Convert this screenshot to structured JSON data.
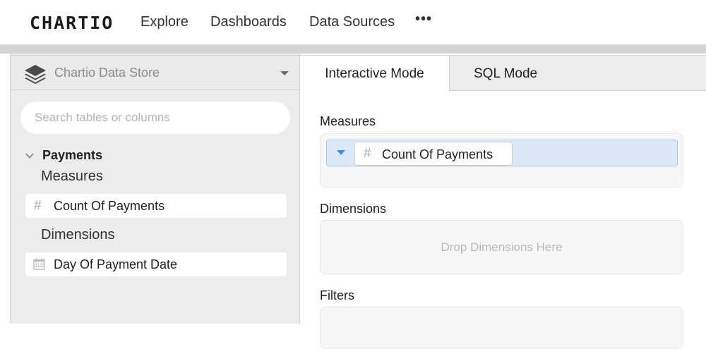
{
  "nav": {
    "logo": "CHARTIO",
    "links": [
      "Explore",
      "Dashboards",
      "Data Sources"
    ],
    "more": "•••"
  },
  "left_panel": {
    "datasource": "Chartio Data Store",
    "search_placeholder": "Search tables or columns",
    "table": "Payments",
    "measures_label": "Measures",
    "measures": [
      {
        "icon": "hash-icon",
        "label": "Count Of Payments"
      }
    ],
    "dimensions_label": "Dimensions",
    "dimensions": [
      {
        "icon": "calendar-icon",
        "label": "Day Of Payment Date"
      }
    ]
  },
  "right_panel": {
    "tabs": [
      {
        "label": "Interactive Mode",
        "active": true
      },
      {
        "label": "SQL Mode",
        "active": false
      }
    ],
    "measures_label": "Measures",
    "measure_pill": "Count Of Payments",
    "dimensions_label": "Dimensions",
    "dimensions_hint": "Drop Dimensions Here",
    "filters_label": "Filters"
  },
  "colors": {
    "accent": "#3a8ee6",
    "pill_bar": "#dde8f6",
    "panel_bg": "#ececec"
  }
}
